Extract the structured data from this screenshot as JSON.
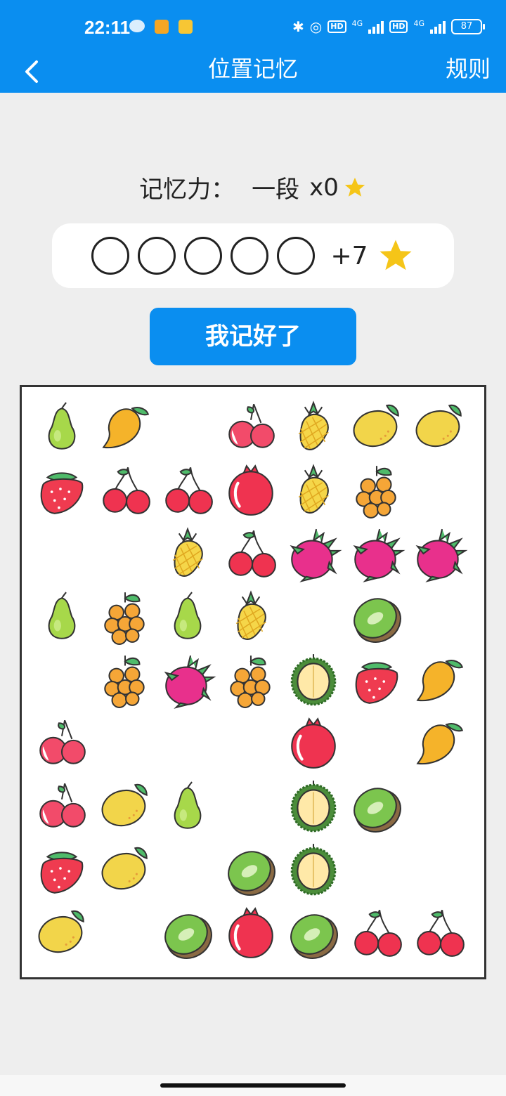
{
  "status": {
    "time": "22:11",
    "network": "4G",
    "hd": "HD",
    "battery": "87"
  },
  "header": {
    "title": "位置记忆",
    "rules_label": "规则"
  },
  "level": {
    "label": "记忆力：",
    "rank": "一段",
    "stars": "x0"
  },
  "progress": {
    "slots": [
      0,
      0,
      0,
      0,
      0
    ],
    "bonus": "+7"
  },
  "ready_button": "我记好了",
  "grid": {
    "cols": 7,
    "rows": 9,
    "cells": [
      [
        "pear",
        "mango",
        "",
        "lychee",
        "pineapple",
        "lemon",
        "lemon"
      ],
      [
        "strawberry",
        "cherry",
        "cherry",
        "pomegranate",
        "pineapple",
        "loquat",
        ""
      ],
      [
        "",
        "",
        "pineapple",
        "cherry",
        "dragonfruit",
        "dragonfruit",
        "dragonfruit"
      ],
      [
        "pear",
        "loquat",
        "pear",
        "pineapple",
        "",
        "kiwi",
        ""
      ],
      [
        "",
        "loquat",
        "dragonfruit",
        "loquat",
        "durian",
        "strawberry",
        "mango"
      ],
      [
        "lychee",
        "",
        "",
        "",
        "pomegranate",
        "",
        "mango"
      ],
      [
        "lychee",
        "lemon",
        "pear",
        "",
        "durian",
        "kiwi",
        ""
      ],
      [
        "strawberry",
        "lemon",
        "",
        "kiwi",
        "durian",
        "",
        ""
      ],
      [
        "lemon",
        "",
        "kiwi",
        "pomegranate",
        "kiwi",
        "cherry",
        "cherry"
      ]
    ]
  },
  "colors": {
    "accent": "#0a8ef0",
    "star": "#f5c518"
  }
}
